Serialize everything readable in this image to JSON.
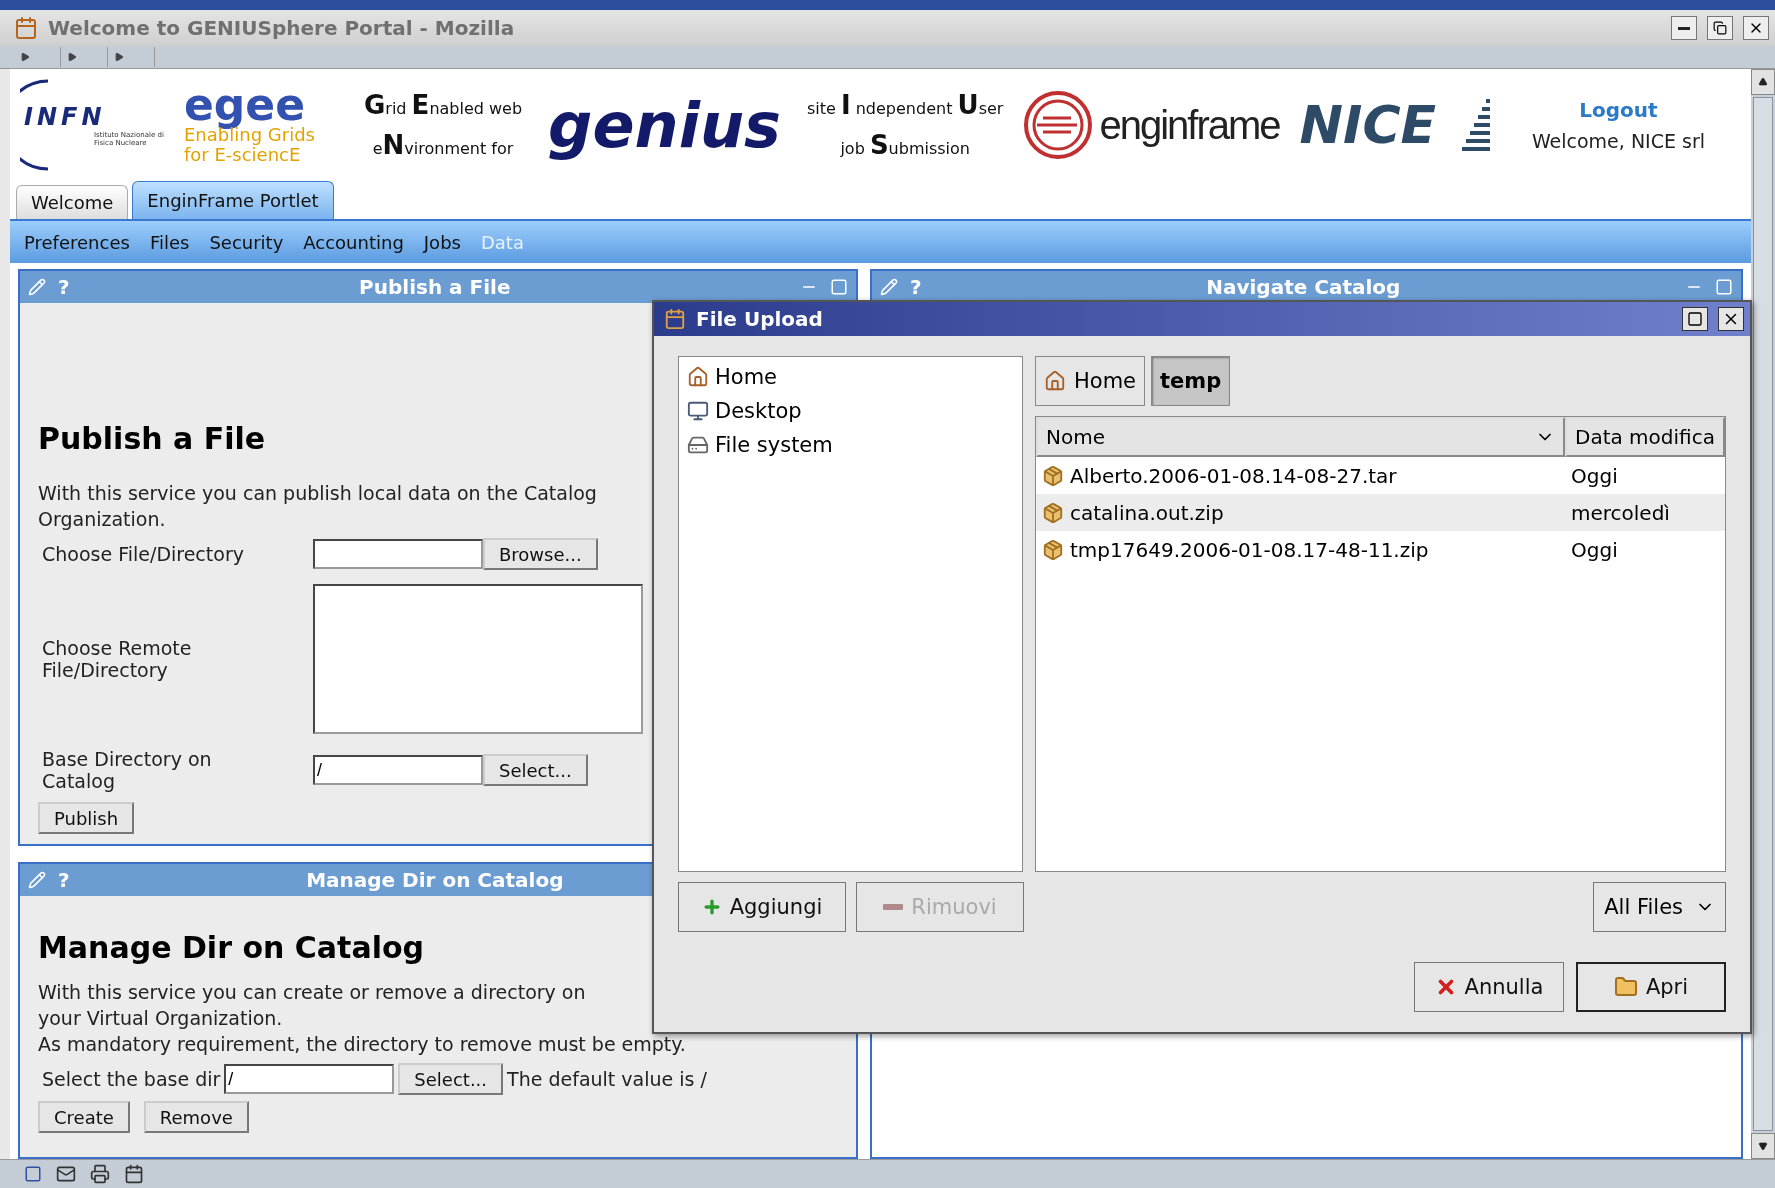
{
  "browser": {
    "title": "Welcome to GENIUSphere Portal - Mozilla"
  },
  "header": {
    "infn": "INFN",
    "infn_caption": "Istituto Nazionale di Fisica Nucleare",
    "egee": "egee",
    "egee_tagline": [
      "Enabling Grids",
      "for E-sciencE"
    ],
    "acronym_left": [
      "**G**rid **E**nabled web",
      "e**N**vironment for"
    ],
    "genius": "genius",
    "acronym_right": [
      "site **I** ndependent **U**ser",
      "job **S**ubmission"
    ],
    "enginframe": "enginframe",
    "nice": "NICE",
    "logout": "Logout",
    "welcome": "Welcome, NICE srl"
  },
  "tabs": [
    {
      "label": "Welcome",
      "selected": false
    },
    {
      "label": "EnginFrame Portlet",
      "selected": true
    }
  ],
  "menu": [
    {
      "label": "Preferences",
      "selected": false
    },
    {
      "label": "Files",
      "selected": false
    },
    {
      "label": "Security",
      "selected": false
    },
    {
      "label": "Accounting",
      "selected": false
    },
    {
      "label": "Jobs",
      "selected": false
    },
    {
      "label": "Data",
      "selected": true
    }
  ],
  "publish_portlet": {
    "header": "Publish a File",
    "help": "?",
    "heading": "Publish a File",
    "description": [
      "With this service you can publish local data on the Catalog",
      "Organization."
    ],
    "fields": [
      {
        "kind": "file",
        "label": "Choose File/Directory",
        "button": "Browse..."
      },
      {
        "kind": "textarea",
        "label": "Choose Remote File/Directory"
      },
      {
        "kind": "select",
        "label": "Base Directory on Catalog",
        "value": "/",
        "button": "Select..."
      }
    ],
    "submit": "Publish"
  },
  "manage_portlet": {
    "header": "Manage Dir on Catalog",
    "help": "?",
    "heading": "Manage Dir on Catalog",
    "description": [
      "With this service you can create or remove a directory on",
      "your Virtual Organization.",
      "As mandatory requirement, the directory to remove must be empty."
    ],
    "base_dir_label": "Select the base dir",
    "base_dir_value": "/",
    "select_button": "Select...",
    "hint": "The default value is /",
    "buttons": [
      "Create",
      "Remove"
    ]
  },
  "catalog_portlet": {
    "header": "Navigate Catalog",
    "help": "?"
  },
  "dialog": {
    "title": "File Upload",
    "places": [
      {
        "label": "Home",
        "kind": "home"
      },
      {
        "label": "Desktop",
        "kind": "desktop"
      },
      {
        "label": "File system",
        "kind": "filesystem"
      }
    ],
    "path": [
      {
        "label": "Home",
        "kind": "home",
        "selected": false
      },
      {
        "label": "temp",
        "kind": "folder",
        "selected": true
      }
    ],
    "columns": [
      "Nome",
      "Data modifica"
    ],
    "rows": [
      {
        "name": "Alberto.2006-01-08.14-08-27.tar",
        "modified": "Oggi"
      },
      {
        "name": "catalina.out.zip",
        "modified": "mercoledì"
      },
      {
        "name": "tmp17649.2006-01-08.17-48-11.zip",
        "modified": "Oggi"
      }
    ],
    "add_button": {
      "label": "Aggiungi",
      "disabled": false
    },
    "remove_button": {
      "label": "Rimuovi",
      "disabled": true
    },
    "filter": "All Files",
    "cancel": "Annulla",
    "open": "Apri"
  }
}
